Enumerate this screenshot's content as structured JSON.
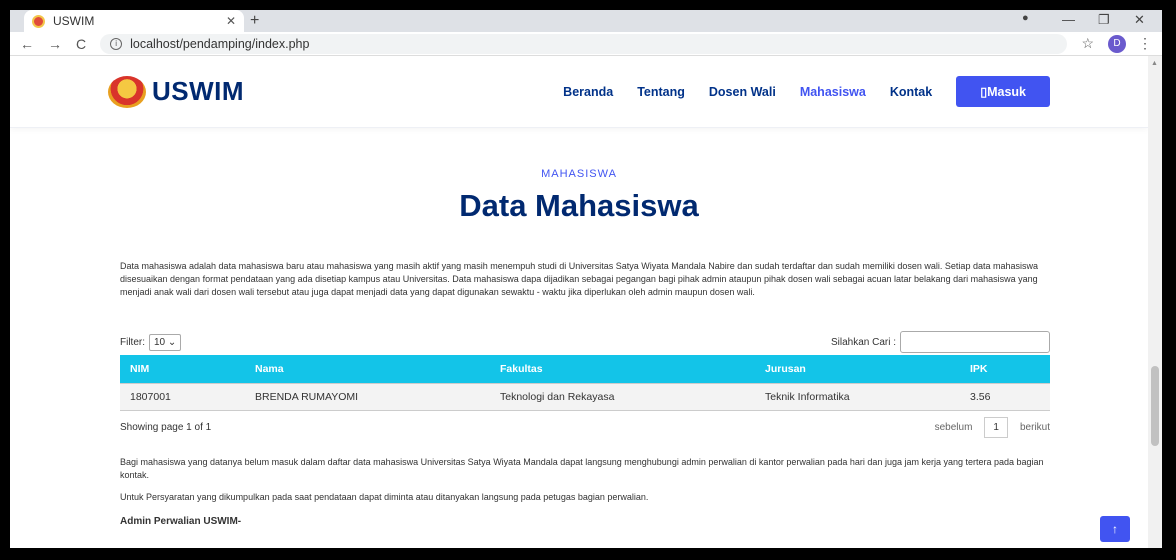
{
  "browser": {
    "tab_title": "USWIM",
    "url": "localhost/pendamping/index.php",
    "profile_initial": "D"
  },
  "header": {
    "logo_text": "USWIM",
    "nav": [
      "Beranda",
      "Tentang",
      "Dosen Wali",
      "Mahasiswa",
      "Kontak"
    ],
    "active_nav": "Mahasiswa",
    "login_label": "Masuk"
  },
  "section": {
    "tag": "MAHASISWA",
    "title": "Data Mahasiswa",
    "intro": "Data mahasiswa adalah data mahasiswa baru atau mahasiswa yang masih aktif yang masih menempuh studi di Universitas Satya Wiyata Mandala Nabire dan sudah terdaftar dan sudah memiliki dosen wali. Setiap data mahasiswa disesuaikan dengan format pendataan yang ada disetiap kampus atau Universitas. Data mahasiswa dapa dijadikan sebagai pegangan bagi pihak admin ataupun pihak dosen wali sebagai acuan latar belakang dari mahasiswa yang menjadi anak wali dari dosen wali tersebut atau juga dapat menjadi data yang dapat digunakan sewaktu - waktu jika diperlukan oleh admin maupun dosen wali."
  },
  "controls": {
    "filter_label": "Filter:",
    "filter_value": "10",
    "search_label": "Silahkan Cari :"
  },
  "table": {
    "headers": [
      "NIM",
      "Nama",
      "Fakultas",
      "Jurusan",
      "IPK"
    ],
    "rows": [
      [
        "1807001",
        "BRENDA RUMAYOMI",
        "Teknologi dan Rekayasa",
        "Teknik Informatika",
        "3.56"
      ]
    ]
  },
  "pagination": {
    "showing": "Showing page 1 of 1",
    "prev": "sebelum",
    "page": "1",
    "next": "berikut"
  },
  "notes": {
    "contact": "Bagi mahasiswa yang datanya belum masuk dalam daftar data mahasiswa Universitas Satya Wiyata Mandala dapat langsung menghubungi admin perwalian di kantor perwalian pada hari dan juga jam kerja yang tertera pada bagian kontak.",
    "requirements": "Untuk Persyaratan yang dikumpulkan pada saat pendataan dapat diminta atau ditanyakan langsung pada petugas bagian perwalian.",
    "admin": "Admin Perwalian USWIM-"
  }
}
